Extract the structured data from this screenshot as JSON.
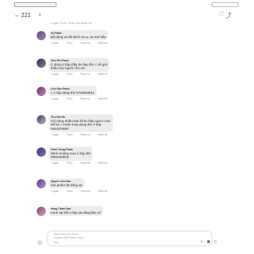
{
  "header": {
    "title": "221",
    "back_icon": "arrow-left-icon",
    "chevron_icon": "chevron-right-icon"
  },
  "top_meta": "1 ngày   Thích   Phản hồi   Nhắn tin",
  "meta_labels": {
    "time": "1 ngày",
    "like": "Thích",
    "reply": "Phản hồi",
    "message": "Nhắn tin"
  },
  "comments": [
    {
      "name": "Vy Pham",
      "lines": [
        "Đã dùng và rất thích mn ạ, da min hẳn"
      ]
    },
    {
      "name": "Tinh Phi Pham",
      "lines": [
        "C dùng 2 hộp thấy da đẹp lắm c sẽ giới",
        "thiệu mọi người cho em"
      ]
    },
    {
      "name": "Linh San Pham",
      "lines": [
        "c 2 hộp dùng thử 0794633914"
      ]
    },
    {
      "name": "Thu Viet Ho",
      "lines": [
        "Chị dùng nhiều loại rồi ko hiệu quả e cam",
        "kết ko c muốn mua dùng thử 4 hộp",
        "0913379097"
      ]
    },
    {
      "name": "Diem Trang Pham",
      "lines": [
        "Mình muống mua 4 hộp dth",
        "0881033916"
      ]
    },
    {
      "name": "Quynh Lien Dao",
      "lines": [
        "sản phẩm tốt trắng da"
      ]
    },
    {
      "name": "Hong Tham Dao",
      "lines": [
        "mình sài hết 4 hộp da trắng lắm nè"
      ]
    }
  ],
  "input": {
    "reply_to": "Bình luận với vai trò",
    "page_name": "Chuyên Mỹ Phẩm Xách",
    "placeholder": "Tay"
  }
}
